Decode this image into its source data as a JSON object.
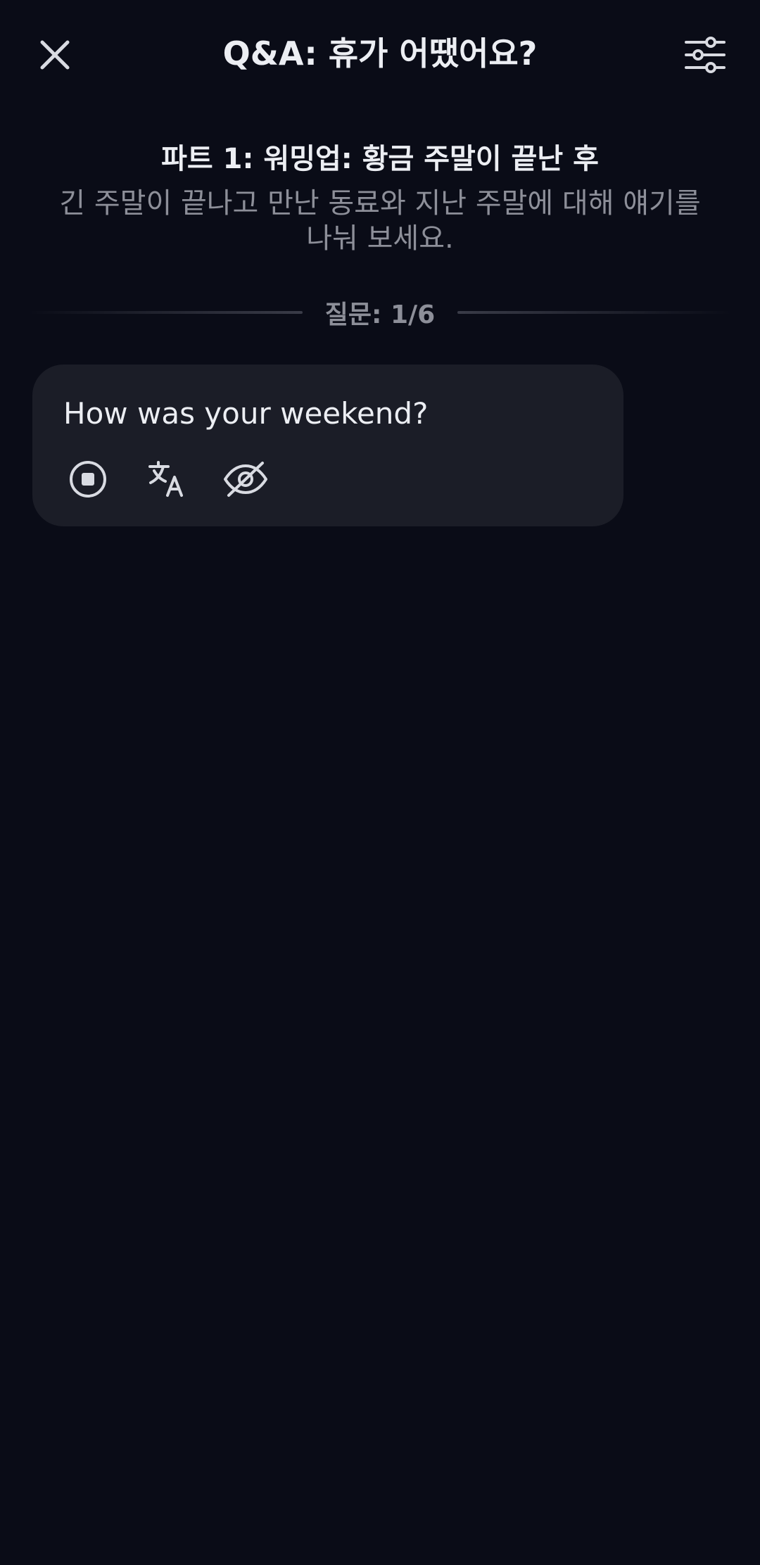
{
  "header": {
    "title": "Q&A: 휴가 어땠어요?",
    "close_icon": "close-icon",
    "settings_icon": "sliders-icon"
  },
  "intro": {
    "part_title": "파트 1: 워밍업: 황금 주말이 끝난 후",
    "description": "긴 주말이 끝나고 만난 동료와 지난 주말에 대해 얘기를 나눠 보세요."
  },
  "progress": {
    "label": "질문: 1/6"
  },
  "message": {
    "text": "How was your weekend?",
    "actions": [
      "stop-icon",
      "translate-icon",
      "eye-off-icon"
    ]
  },
  "colors": {
    "background": "#0a0c17",
    "bubble": "#1b1d27",
    "text_primary": "#eceef3",
    "text_secondary": "#8d8f99",
    "icon": "#d9dbe2"
  }
}
